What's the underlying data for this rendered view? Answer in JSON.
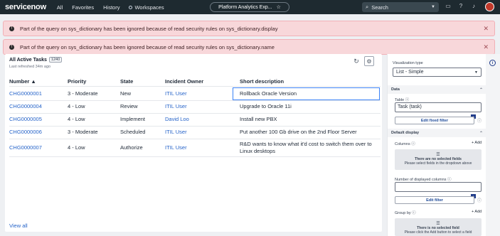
{
  "topnav": {
    "logo": "servicenow",
    "links": [
      "All",
      "Favorites",
      "History",
      "Workspaces"
    ],
    "center_title": "Platform Analytics Exp...",
    "search_placeholder": "Search",
    "accent_color": "#7fd35b"
  },
  "alerts": [
    {
      "text": "Part of the query on sys_dictionary has been ignored because of read security rules on sys_dictionary.display"
    },
    {
      "text": "Part of the query on sys_dictionary has been ignored because of read security rules on sys_dictionary.name"
    }
  ],
  "list": {
    "title": "All Active Tasks",
    "count": "1240",
    "last_refreshed": "Last refreshed 34m ago",
    "columns": [
      "Number ▲",
      "Priority",
      "State",
      "Incident Owner",
      "Short description"
    ],
    "rows": [
      {
        "number": "CHG0000001",
        "priority": "3 - Moderate",
        "state": "New",
        "owner": "ITIL User",
        "desc": "Rollback Oracle Version"
      },
      {
        "number": "CHG0000004",
        "priority": "4 - Low",
        "state": "Review",
        "owner": "ITIL User",
        "desc": "Upgrade to Oracle 11i"
      },
      {
        "number": "CHG0000005",
        "priority": "4 - Low",
        "state": "Implement",
        "owner": "David Loo",
        "desc": "Install new PBX"
      },
      {
        "number": "CHG0000006",
        "priority": "3 - Moderate",
        "state": "Scheduled",
        "owner": "ITIL User",
        "desc": "Put another 100 Gb drive on the 2nd Floor Server"
      },
      {
        "number": "CHG0000007",
        "priority": "4 - Low",
        "state": "Authorize",
        "owner": "ITIL User",
        "desc": "R&D wants to know what it'd cost to switch them over to Linux desktops"
      }
    ],
    "view_all": "View all"
  },
  "config": {
    "viz_type_label": "Visualization type",
    "viz_type_value": "List - Simple",
    "data_section": "Data",
    "table_label": "Table",
    "table_value": "Task (task)",
    "edit_fixed_filter": "Edit fixed filter",
    "filter_count": "0",
    "default_display_section": "Default display",
    "columns_label": "Columns",
    "add_label": "+ Add",
    "no_fields_title": "There are no selected fields",
    "no_fields_hint": "Please select fields in the dropdown above",
    "num_columns_label": "Number of displayed columns",
    "num_columns_value": "",
    "edit_filter": "Edit filter",
    "group_by_label": "Group by",
    "no_field_title": "There is no selected field",
    "no_field_hint": "Please click the Add button to select a field"
  }
}
